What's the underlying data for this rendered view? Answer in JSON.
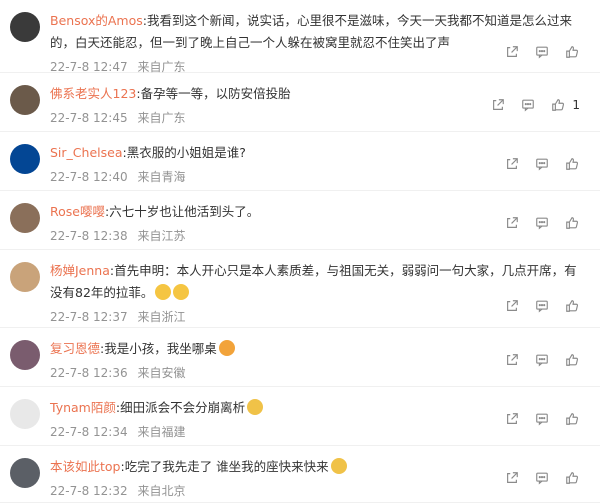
{
  "comments": [
    {
      "user": "Bensox的Amos",
      "text": "我看到这个新闻，说实话，心里很不是滋味，今天一天我都不知道是怎么过来的，白天还能忍，但一到了晚上自己一个人躲在被窝里就忍不住笑出了声",
      "date": "22-7-8 12:47",
      "location": "来自广东",
      "likes": "",
      "avatar_color": "#3a3a3a"
    },
    {
      "user": "佛系老实人123",
      "text": "备孕等一等，以防安倍投胎",
      "date": "22-7-8 12:45",
      "location": "来自广东",
      "likes": "1",
      "avatar_color": "#6b5a4a"
    },
    {
      "user": "Sir_Chelsea",
      "text": "黑衣服的小姐姐是谁?",
      "date": "22-7-8 12:40",
      "location": "来自青海",
      "likes": "",
      "avatar_color": "#034694"
    },
    {
      "user": "Rose嘤嘤",
      "text": "六七十岁也让他活到头了。",
      "date": "22-7-8 12:38",
      "location": "来自江苏",
      "likes": "",
      "avatar_color": "#8a6f5a"
    },
    {
      "user": "杨婵Jenna",
      "text": "首先申明：本人开心只是本人素质差，与祖国无关，弱弱问一句大家，几点开席，有没有82年的拉菲。",
      "date": "22-7-8 12:37",
      "location": "来自浙江",
      "likes": "",
      "avatar_color": "#c9a37a"
    },
    {
      "user": "复习恩德",
      "text": "我是小孩，我坐哪桌",
      "date": "22-7-8 12:36",
      "location": "来自安徽",
      "likes": "",
      "avatar_color": "#7a5c6e"
    },
    {
      "user": "Tynam陌颜",
      "text": "细田派会不会分崩离析",
      "date": "22-7-8 12:34",
      "location": "来自福建",
      "likes": "",
      "avatar_color": "#e8e8e8"
    },
    {
      "user": "本该如此top",
      "text": "吃完了我先走了 谁坐我的座快来快来",
      "date": "22-7-8 12:32",
      "location": "来自北京",
      "likes": "",
      "avatar_color": "#5b5f66"
    }
  ],
  "icons": {
    "share": "share-icon",
    "comment": "comment-icon",
    "like": "thumbs-up-icon"
  },
  "colors": {
    "username": "#eb7350",
    "meta": "#939393",
    "text": "#333333"
  }
}
